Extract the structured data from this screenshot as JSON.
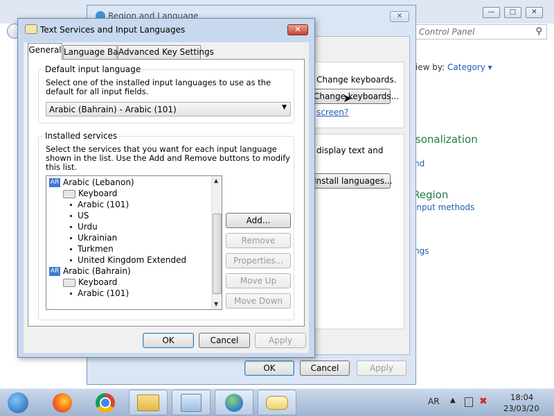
{
  "control_panel": {
    "title": "Region and Language",
    "search_placeholder": "Control Panel",
    "view_by_label": "View by:",
    "view_by_value": "Category",
    "keyboards_text": "Change keyboards.",
    "keyboards_button": "Change keyboards...",
    "screen_link": "screen?",
    "display_text": "display text and",
    "install_button": "Install languages...",
    "personalization": "Personalization",
    "personalization_link": "nd",
    "region_title": "Region",
    "region_link": "input methods",
    "other_link": "ngs"
  },
  "region_dialog": {
    "title": "Region and Language",
    "ok": "OK",
    "cancel": "Cancel",
    "apply": "Apply"
  },
  "text_services": {
    "title": "Text Services and Input Languages",
    "tabs": [
      "General",
      "Language Bar",
      "Advanced Key Settings"
    ],
    "default_group": {
      "title": "Default input language",
      "description": "Select one of the installed input languages to use as the default for all input fields.",
      "selected": "Arabic (Bahrain) - Arabic (101)"
    },
    "installed_group": {
      "title": "Installed services",
      "description": "Select the services that you want for each input language shown in the list. Use the Add and Remove buttons to modify this list."
    },
    "tree": {
      "languages": [
        {
          "badge": "AR",
          "name": "Arabic (Lebanon)",
          "category": "Keyboard",
          "layouts": [
            "Arabic (101)",
            "US",
            "Urdu",
            "Ukrainian",
            "Turkmen",
            "United Kingdom Extended"
          ]
        },
        {
          "badge": "AR",
          "name": "Arabic (Bahrain)",
          "category": "Keyboard",
          "layouts": [
            "Arabic (101)"
          ]
        }
      ]
    },
    "buttons": {
      "add": "Add...",
      "remove": "Remove",
      "properties": "Properties...",
      "move_up": "Move Up",
      "move_down": "Move Down",
      "ok": "OK",
      "cancel": "Cancel",
      "apply": "Apply"
    }
  },
  "taskbar": {
    "language": "AR",
    "time": "18:04",
    "date": "23/03/20",
    "items": [
      "start-orb",
      "firefox-icon",
      "chrome-icon",
      "file-explorer-icon",
      "control-panel-icon",
      "region-language-icon",
      "keyboard-input-icon"
    ]
  }
}
